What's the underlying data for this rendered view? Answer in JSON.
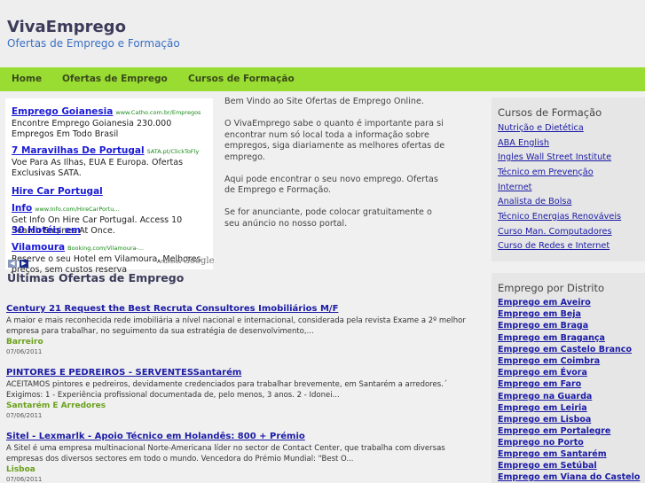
{
  "header": {
    "title": "VivaEmprego",
    "tagline": "Ofertas de Emprego e Formação"
  },
  "nav": {
    "items": [
      "Home",
      "Ofertas de Emprego",
      "Cursos de Formação"
    ]
  },
  "ads": {
    "items": [
      {
        "title": "Emprego Goianesia",
        "url": "www.Catho.com.br/Empregos",
        "text": "Encontre Emprego Goianesia 230.000 Empregos Em Todo Brasil"
      },
      {
        "title": "7 Maravilhas De Portugal",
        "url": "SATA.pt/ClickToFly",
        "text": "Voe Para As Ilhas, EUA E Europa. Ofertas Exclusivas SATA."
      },
      {
        "title": "Hire Car Portugal Info",
        "url": "www.Info.com/HireCarPortu...",
        "text": "Get Info On Hire Car Portugal. Access 10 Search Engines At Once."
      },
      {
        "title": "30 Hotéis em Vilamoura",
        "url": "Booking.com/Vilamoura-...",
        "text": "Reserve o seu Hotel em Vilamoura. Melhores preços, sem custos reserva"
      }
    ],
    "ads_by_label": "Anúncios",
    "google_label": "Google",
    "prev_icon": "arrow-left-icon",
    "next_icon": "arrow-right-icon"
  },
  "welcome": {
    "paragraphs": [
      "Bem Vindo ao Site Ofertas de Emprego Online.",
      "O VivaEmprego sabe o quanto é importante para si encontrar num só local toda a informação sobre empregos, siga diariamente as melhores ofertas de emprego.",
      "Aqui pode encontrar o seu novo emprego. Ofertas de Emprego e Formação.",
      "Se for anunciante, pode colocar gratuitamente o seu anúncio no nosso portal."
    ]
  },
  "offers": {
    "heading": "Últimas Ofertas de Emprego",
    "items": [
      {
        "title": "Century 21 Request the Best Recruta Consultores Imobiliários M/F",
        "desc": "A maior e mais reconhecida rede imobiliária a nível nacional e internacional, considerada pela revista Exame a 2º melhor empresa para trabalhar, no seguimento da sua estratégia de desenvolvimento,...",
        "location": "Barreiro",
        "date": "07/06/2011"
      },
      {
        "title": "PINTORES E PEDREIROS - SERVENTESSantarém",
        "desc": "ACEITAMOS pintores e pedreiros, devidamente credenciados para trabalhar brevemente, em Santarém a arredores.´ Exigimos: 1 - Experiência profissional documentada de, pelo menos, 3 anos. 2 - Idonei...",
        "location": "Santarém E Arredores",
        "date": "07/06/2011"
      },
      {
        "title": "Sitel - Lexmarlk - Apoio Técnico em Holandês: 800 + Prémio",
        "desc": "A Sitel é uma empresa multinacional Norte-Americana líder no sector de Contact Center, que trabalha com diversas empresas dos diversos sectores em todo o mundo. Vencedora do Prémio Mundial: \"Best O...",
        "location": "Lisboa",
        "date": "07/06/2011"
      }
    ]
  },
  "courses": {
    "heading": "Cursos de Formação",
    "items": [
      "Nutrição e Dietética",
      "ABA English",
      "Ingles Wall Street Institute",
      "Técnico em Prevenção",
      "Internet",
      "Analista de Bolsa",
      "Técnico Energias Renováveis",
      "Curso Man. Computadores",
      "Curso de Redes e Internet"
    ]
  },
  "districts": {
    "heading": "Emprego por Distrito",
    "items": [
      "Emprego em Aveiro",
      "Emprego em Beja",
      "Emprego em Braga",
      "Emprego em Bragança",
      "Emprego em Castelo Branco",
      "Emprego em Coimbra",
      "Emprego em Évora",
      "Emprego em Faro",
      "Emprego na Guarda",
      "Emprego em Leiria",
      "Emprego em Lisboa",
      "Emprego em Portalegre",
      "Emprego no Porto",
      "Emprego em Santarém",
      "Emprego em Setúbal",
      "Emprego em Viana do Castelo"
    ]
  },
  "colors": {
    "nav_bar": "#99dd33",
    "link": "#1a1aa6",
    "location": "#6aa01a",
    "tagline": "#3b6fc4"
  }
}
